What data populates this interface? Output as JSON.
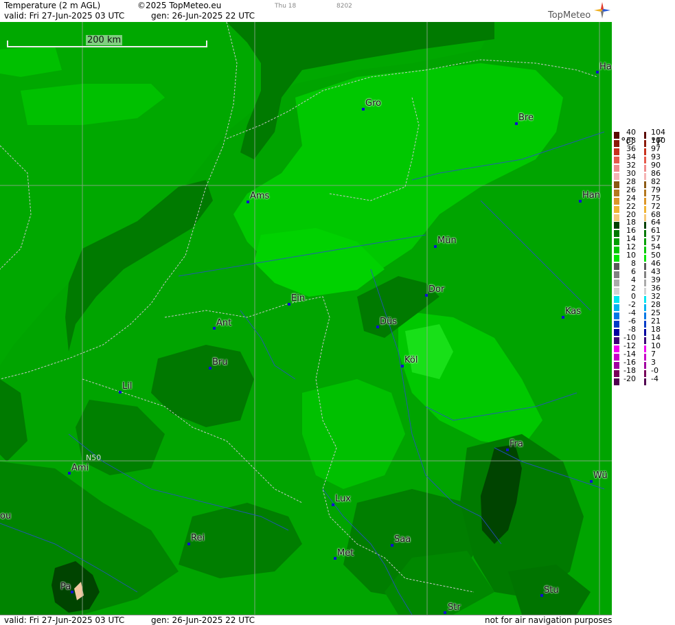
{
  "header": {
    "title": "Temperature (2 m AGL)",
    "copyright": "©2025 TopMeteo.eu",
    "valid": "valid:  Fri  27-Jun-2025  03 UTC",
    "gen": "gen: 26-Jun-2025 22 UTC",
    "aux1": "Thu 18",
    "aux2": "8202",
    "brand": "TopMeteo"
  },
  "footer": {
    "valid": "valid:  Fri  27-Jun-2025  03 UTC",
    "gen": "gen: 26-Jun-2025 22 UTC",
    "note": "not for air navigation purposes"
  },
  "map": {
    "scale_label": "200 km",
    "latitude_label": "N50",
    "cities": [
      {
        "name": "Ha"
      },
      {
        "name": "Gro"
      },
      {
        "name": "Bre"
      },
      {
        "name": "Ams"
      },
      {
        "name": "Han"
      },
      {
        "name": "Mün"
      },
      {
        "name": "Dor"
      },
      {
        "name": "Ein"
      },
      {
        "name": "Kas"
      },
      {
        "name": "Ant"
      },
      {
        "name": "Düs"
      },
      {
        "name": "Köl"
      },
      {
        "name": "Bru"
      },
      {
        "name": "Lil"
      },
      {
        "name": "Fra"
      },
      {
        "name": "Ami"
      },
      {
        "name": "Wü"
      },
      {
        "name": "Lux"
      },
      {
        "name": "ou"
      },
      {
        "name": "Rei"
      },
      {
        "name": "Saa"
      },
      {
        "name": "Met"
      },
      {
        "name": "Stu"
      },
      {
        "name": "Pa"
      },
      {
        "name": "Str"
      }
    ]
  },
  "legend": {
    "celsius_unit": "°C",
    "fahrenheit_unit": "°F",
    "celsius": [
      "40",
      "38",
      "36",
      "34",
      "32",
      "30",
      "28",
      "26",
      "24",
      "22",
      "20",
      "18",
      "16",
      "14",
      "12",
      "10",
      "8",
      "6",
      "4",
      "2",
      "0",
      "-2",
      "-4",
      "-6",
      "-8",
      "-10",
      "-12",
      "-14",
      "-16",
      "-18",
      "-20"
    ],
    "fahrenheit": [
      "104",
      "100",
      "97",
      "93",
      "90",
      "86",
      "82",
      "79",
      "75",
      "72",
      "68",
      "64",
      "61",
      "57",
      "54",
      "50",
      "46",
      "43",
      "39",
      "36",
      "32",
      "28",
      "25",
      "21",
      "18",
      "14",
      "10",
      "7",
      "3",
      "-0",
      "-4"
    ],
    "colors": [
      "#5a0a00",
      "#8c1a0a",
      "#c8321e",
      "#e65a4b",
      "#f08c8c",
      "#f5b4b4",
      "#8c5a14",
      "#b4781e",
      "#dc9628",
      "#f0b432",
      "#f5c878",
      "#004100",
      "#007800",
      "#00a000",
      "#00c800",
      "#00e600",
      "#5a5a5a",
      "#828282",
      "#aaaaaa",
      "#d2d2d2",
      "#00e6f0",
      "#00b4f0",
      "#0078e6",
      "#003cc8",
      "#0000a0",
      "#3c0078",
      "#f000f0",
      "#c800c8",
      "#a000a0",
      "#78005a",
      "#500050"
    ]
  }
}
